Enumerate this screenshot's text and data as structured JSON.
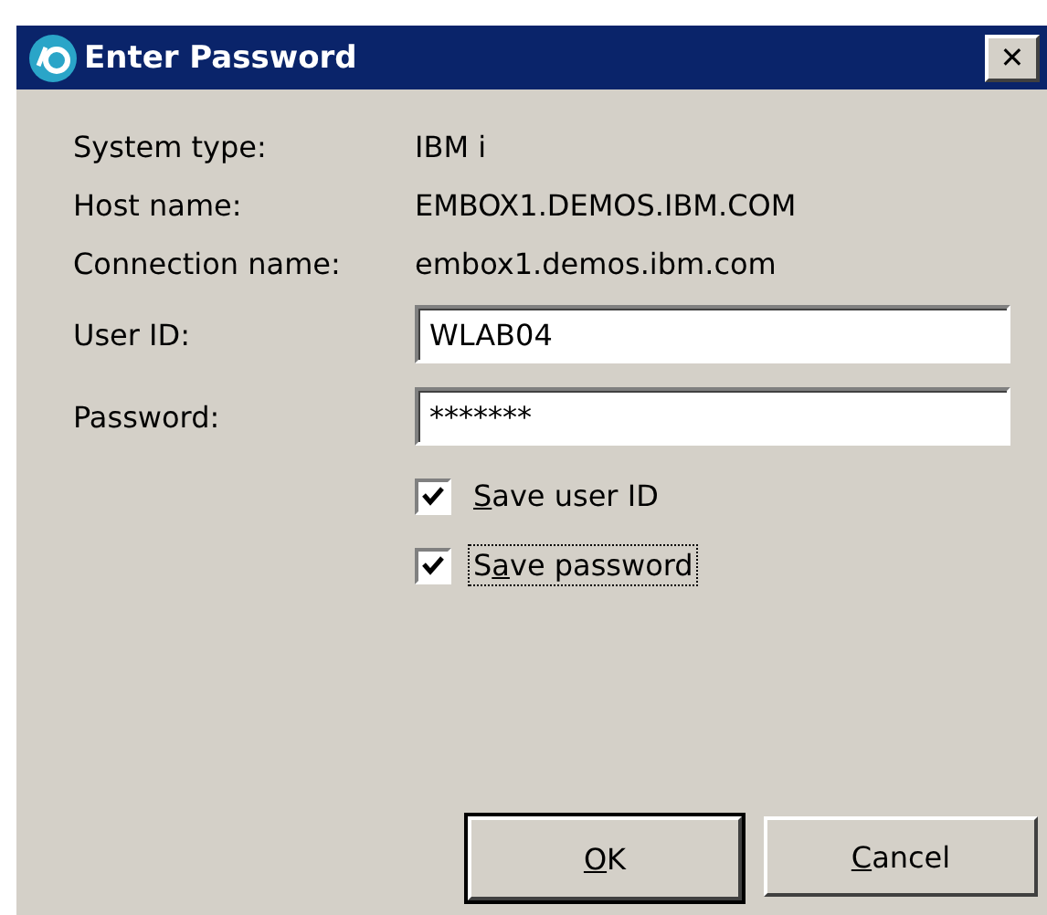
{
  "window": {
    "title": "Enter Password",
    "close_label": "✕"
  },
  "info": [
    {
      "label": "System type:",
      "value": "IBM i"
    },
    {
      "label": "Host name:",
      "value": "EMBOX1.DEMOS.IBM.COM"
    },
    {
      "label": "Connection name:",
      "value": "embox1.demos.ibm.com"
    }
  ],
  "fields": [
    {
      "label": "User ID:",
      "value": "WLAB04"
    },
    {
      "label": "Password:",
      "value": "*******"
    }
  ],
  "checkboxes": [
    {
      "label_parts": [
        {
          "text": "S",
          "underlined": true
        },
        {
          "text": "ave user ID",
          "underlined": false
        }
      ],
      "checked": true,
      "focused": false
    },
    {
      "label_parts": [
        {
          "text": "S",
          "underlined": false
        },
        {
          "text": "a",
          "underlined": true
        },
        {
          "text": "ve password",
          "underlined": false
        }
      ],
      "checked": true,
      "focused": true
    }
  ],
  "buttons": [
    {
      "label_parts": [
        {
          "text": "O",
          "underlined": true
        },
        {
          "text": "K",
          "underlined": false
        }
      ],
      "default": true
    },
    {
      "label_parts": [
        {
          "text": "C",
          "underlined": true
        },
        {
          "text": "ancel",
          "underlined": false
        }
      ],
      "default": false
    }
  ]
}
